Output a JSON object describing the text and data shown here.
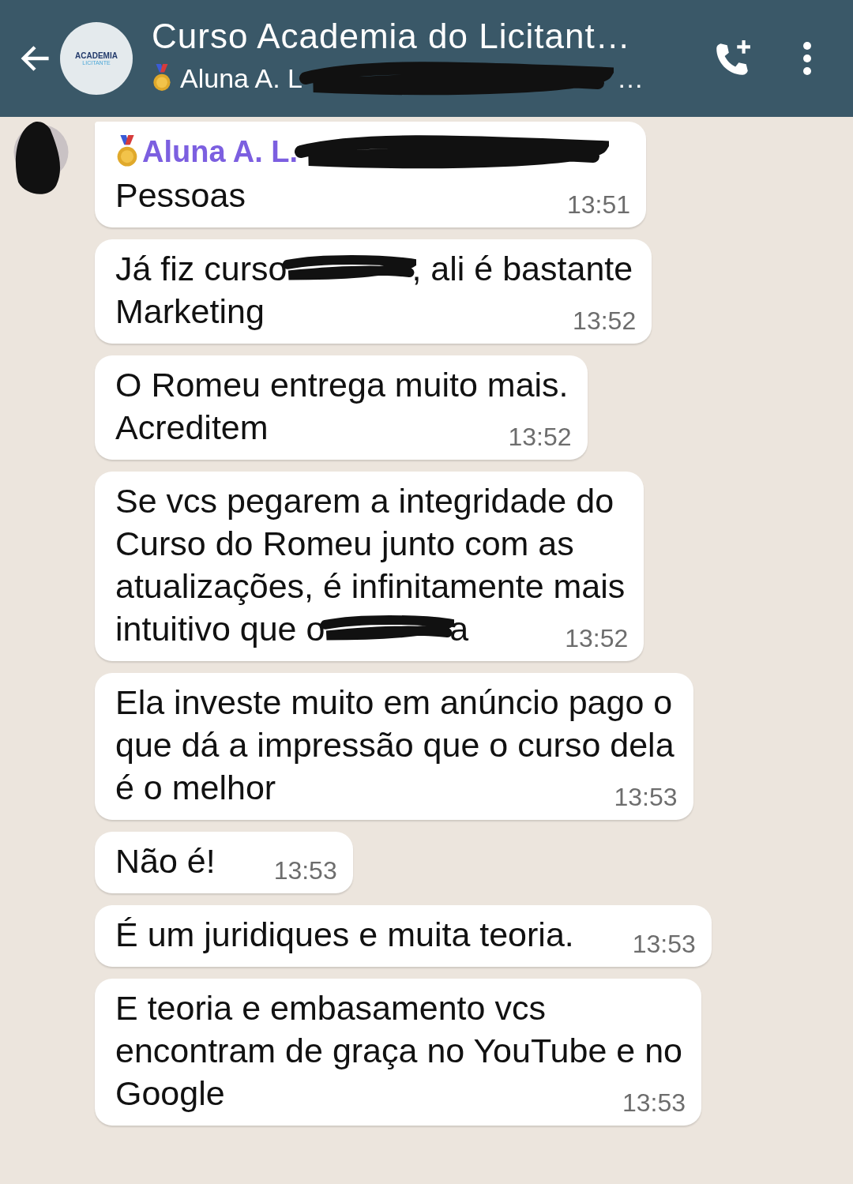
{
  "header": {
    "title": "Curso Academia do Licitant…",
    "logo": {
      "line_1": "ACADEMIA",
      "line_2": "LICITANTE"
    },
    "subtitle": [
      {
        "kind": "medal"
      },
      {
        "kind": "text",
        "text": "Aluna A. L"
      },
      {
        "kind": "redaction"
      },
      {
        "kind": "text",
        "text": "…"
      }
    ]
  },
  "messages": [
    {
      "sender": [
        {
          "kind": "medal"
        },
        {
          "kind": "text",
          "text": "Aluna A. L."
        },
        {
          "kind": "redaction"
        }
      ],
      "lines": [
        [
          {
            "kind": "text",
            "text": "Pessoas"
          }
        ]
      ],
      "time": "13:51"
    },
    {
      "lines": [
        [
          {
            "kind": "text",
            "text": "Já fiz curso"
          },
          {
            "kind": "redaction"
          },
          {
            "kind": "text",
            "text": ", ali é bastante"
          }
        ],
        [
          {
            "kind": "text",
            "text": "Marketing"
          }
        ]
      ],
      "time": "13:52"
    },
    {
      "lines": [
        [
          {
            "kind": "text",
            "text": "O Romeu entrega muito mais."
          }
        ],
        [
          {
            "kind": "text",
            "text": "Acreditem"
          }
        ]
      ],
      "time": "13:52"
    },
    {
      "lines": [
        [
          {
            "kind": "text",
            "text": "Se vcs pegarem a integridade do"
          }
        ],
        [
          {
            "kind": "text",
            "text": "Curso do Romeu junto com as"
          }
        ],
        [
          {
            "kind": "text",
            "text": "atualizações, é infinitamente mais"
          }
        ],
        [
          {
            "kind": "text",
            "text": "intuitivo que o"
          },
          {
            "kind": "redaction"
          },
          {
            "kind": "text",
            "text": "a"
          }
        ]
      ],
      "time": "13:52"
    },
    {
      "lines": [
        [
          {
            "kind": "text",
            "text": "Ela investe muito em anúncio pago o"
          }
        ],
        [
          {
            "kind": "text",
            "text": "que dá a impressão que o curso dela"
          }
        ],
        [
          {
            "kind": "text",
            "text": "é o melhor"
          }
        ]
      ],
      "time": "13:53"
    },
    {
      "lines": [
        [
          {
            "kind": "text",
            "text": "Não é!"
          }
        ]
      ],
      "time": "13:53"
    },
    {
      "lines": [
        [
          {
            "kind": "text",
            "text": "É um juridiques e muita teoria."
          }
        ]
      ],
      "time": "13:53"
    },
    {
      "lines": [
        [
          {
            "kind": "text",
            "text": "E teoria e embasamento vcs"
          }
        ],
        [
          {
            "kind": "text",
            "text": "encontram de graça no YouTube e no"
          }
        ],
        [
          {
            "kind": "text",
            "text": "Google"
          }
        ]
      ],
      "time": "13:53"
    }
  ]
}
